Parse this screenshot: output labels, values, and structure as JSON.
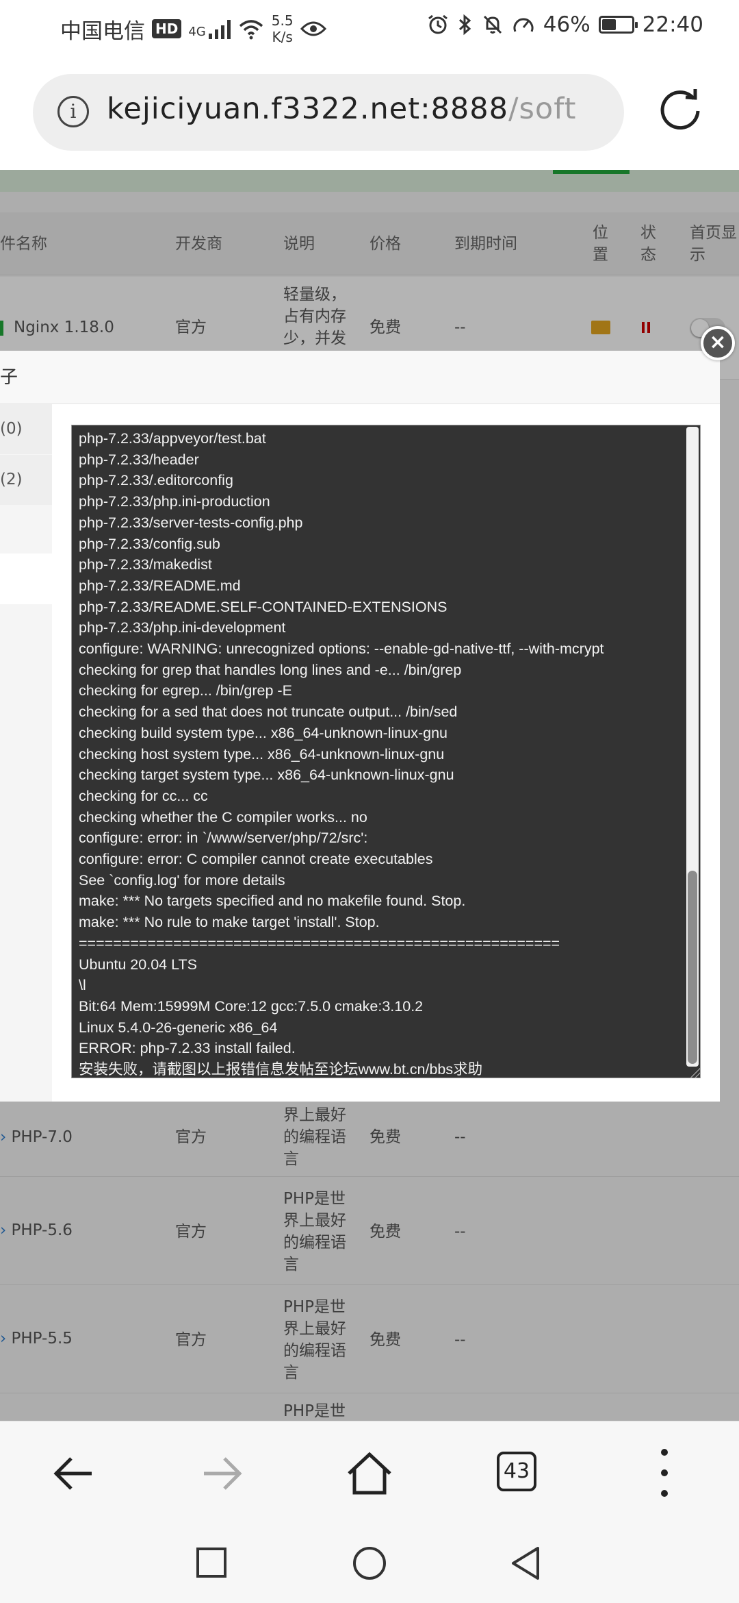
{
  "status_bar": {
    "carrier": "中国电信",
    "hd": "HD",
    "network_type": "4G",
    "speed_value": "5.5",
    "speed_unit": "K/s",
    "battery": "46%",
    "battery_level": 0.46,
    "time": "22:40"
  },
  "browser": {
    "url_host": "kejiciyuan.f3322.net:8888",
    "url_path": "/soft",
    "tab_count": "43"
  },
  "table": {
    "headers": {
      "name": "件名称",
      "developer": "开发商",
      "description": "说明",
      "price": "价格",
      "expire": "到期时间",
      "location_1": "位",
      "location_2": "置",
      "status_1": "状",
      "status_2": "态",
      "homepage_1": "首页显",
      "homepage_2": "示"
    },
    "rows": [
      {
        "name": "Nginx 1.18.0",
        "developer": "官方",
        "desc_1": "轻量级，",
        "desc_2": "占有内存",
        "desc_3": "少，并发",
        "price": "免费",
        "expire": "--"
      },
      {
        "name": "PHP-7.0",
        "developer": "官方",
        "desc_1": "界上最好",
        "desc_2": "的编程语",
        "desc_3": "言",
        "price": "免费",
        "expire": "--"
      },
      {
        "name": "PHP-5.6",
        "developer": "官方",
        "desc_1": "PHP是世",
        "desc_2": "界上最好",
        "desc_3": "的编程语",
        "desc_4": "言",
        "price": "免费",
        "expire": "--"
      },
      {
        "name": "PHP-5.5",
        "developer": "官方",
        "desc_1": "PHP是世",
        "desc_2": "界上最好",
        "desc_3": "的编程语",
        "desc_4": "言",
        "price": "免费",
        "expire": "--"
      },
      {
        "desc_1": "PHP是世"
      }
    ]
  },
  "modal": {
    "title": "子",
    "side_item_1": "(0)",
    "side_item_2": "(2)",
    "close_label": "×",
    "log_lines": [
      "php-7.2.33/appveyor/test.bat",
      "php-7.2.33/header",
      "php-7.2.33/.editorconfig",
      "php-7.2.33/php.ini-production",
      "php-7.2.33/server-tests-config.php",
      "php-7.2.33/config.sub",
      "php-7.2.33/makedist",
      "php-7.2.33/README.md",
      "php-7.2.33/README.SELF-CONTAINED-EXTENSIONS",
      "php-7.2.33/php.ini-development",
      "configure: WARNING: unrecognized options: --enable-gd-native-ttf, --with-mcrypt",
      "checking for grep that handles long lines and -e... /bin/grep",
      "checking for egrep... /bin/grep -E",
      "checking for a sed that does not truncate output... /bin/sed",
      "checking build system type... x86_64-unknown-linux-gnu",
      "checking host system type... x86_64-unknown-linux-gnu",
      "checking target system type... x86_64-unknown-linux-gnu",
      "checking for cc... cc",
      "checking whether the C compiler works... no",
      "configure: error: in `/www/server/php/72/src':",
      "configure: error: C compiler cannot create executables",
      "See `config.log' for more details",
      "make: *** No targets specified and no makefile found.  Stop.",
      "make: *** No rule to make target 'install'.  Stop.",
      "========================================================",
      "Ubuntu 20.04 LTS",
      " \\l",
      "Bit:64 Mem:15999M Core:12 gcc:7.5.0 cmake:3.10.2",
      "Linux 5.4.0-26-generic x86_64",
      "ERROR: php-7.2.33 install failed.",
      "安装失败，请截图以上报错信息发帖至论坛www.bt.cn/bbs求助"
    ]
  },
  "colors": {
    "terminal_bg": "#333333",
    "terminal_text": "#f2f2f2",
    "accent_green": "#20a53a",
    "status_red": "#cc0000"
  }
}
